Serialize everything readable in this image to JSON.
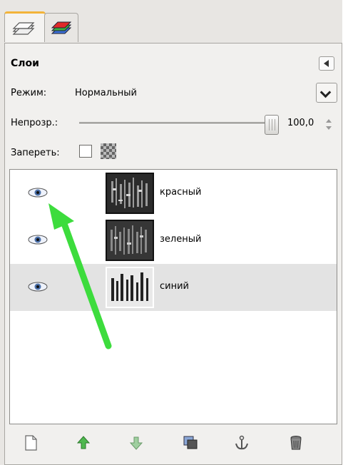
{
  "tabs": [
    {
      "name": "layers",
      "icon": "layers-tab-icon",
      "active": true
    },
    {
      "name": "channels",
      "icon": "channels-tab-icon",
      "active": false
    }
  ],
  "panel": {
    "title": "Слои",
    "mode_label": "Режим:",
    "mode_value": "Нормальный",
    "opacity_label": "Непрозр.:",
    "opacity_value": "100,0",
    "lock_label": "Запереть:"
  },
  "layers": [
    {
      "name": "красный",
      "visible": true,
      "selected": false
    },
    {
      "name": "зеленый",
      "visible": true,
      "selected": false
    },
    {
      "name": "синий",
      "visible": true,
      "selected": true
    }
  ],
  "toolbar": [
    "new-layer-icon",
    "raise-layer-icon",
    "lower-layer-icon",
    "duplicate-layer-icon",
    "anchor-layer-icon",
    "delete-layer-icon"
  ],
  "colors": {
    "accent_tab": "#f3b43a",
    "arrow": "#3ddc3d",
    "selected_row": "#e3e3e3"
  }
}
